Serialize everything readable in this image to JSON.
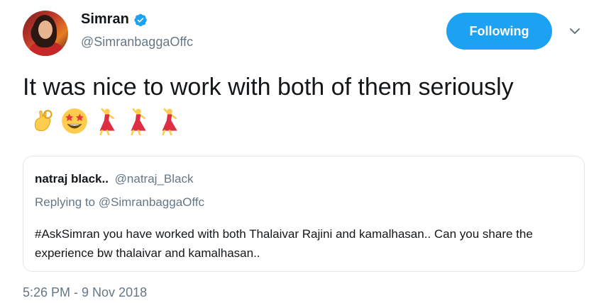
{
  "tweet": {
    "author_name": "Simran",
    "author_handle": "@SimranbaggaOffc",
    "follow_label": "Following",
    "text": "It was nice to work with both of them seriously",
    "emojis": [
      "ok-hand-icon",
      "star-struck-icon",
      "dancer-icon",
      "dancer-icon",
      "dancer-icon"
    ],
    "timestamp": "5:26 PM - 9 Nov 2018"
  },
  "quoted": {
    "author_name": "natraj black..",
    "author_handle": "@natraj_Black",
    "replying_to": "Replying to @SimranbaggaOffc",
    "text": "#AskSimran you have worked with both Thalaivar Rajini and kamalhasan.. Can you share the experience bw thalaivar and kamalhasan.."
  },
  "colors": {
    "accent": "#1da1f2",
    "text_primary": "#14171a",
    "text_secondary": "#657786",
    "border": "#e1e8ed"
  }
}
